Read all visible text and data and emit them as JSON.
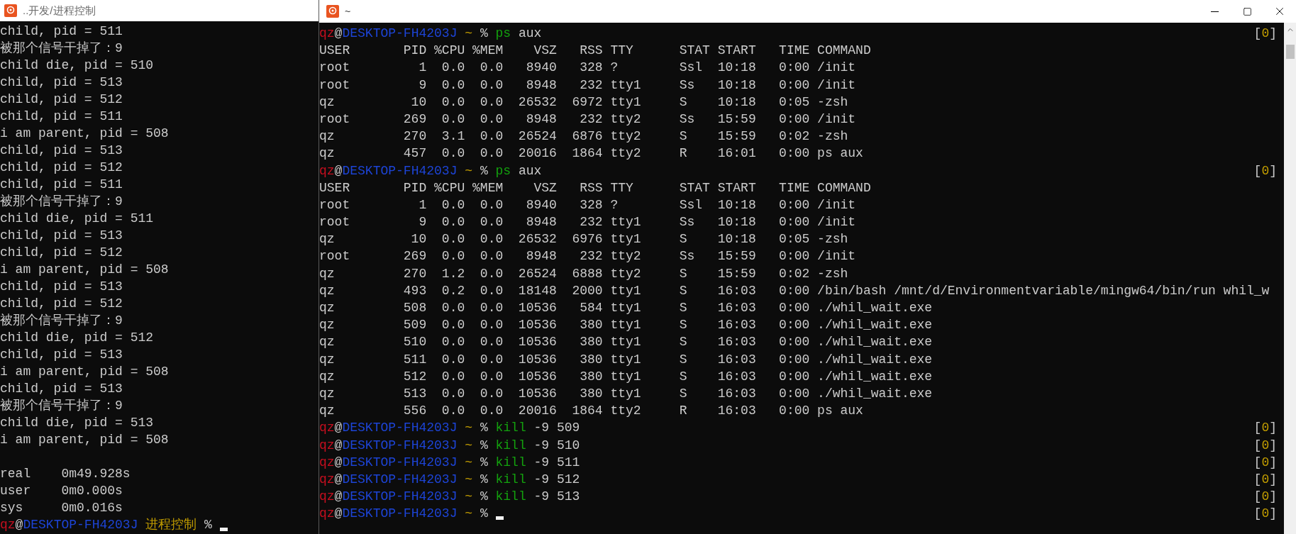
{
  "windows": [
    {
      "title": "..开发/进程控制",
      "lines": [
        {
          "kind": "output",
          "text": "child, pid = 511"
        },
        {
          "kind": "output",
          "text": "被那个信号干掉了：9"
        },
        {
          "kind": "output",
          "text": "child die, pid = 510"
        },
        {
          "kind": "output",
          "text": "child, pid = 513"
        },
        {
          "kind": "output",
          "text": "child, pid = 512"
        },
        {
          "kind": "output",
          "text": "child, pid = 511"
        },
        {
          "kind": "output",
          "text": "i am parent, pid = 508"
        },
        {
          "kind": "output",
          "text": "child, pid = 513"
        },
        {
          "kind": "output",
          "text": "child, pid = 512"
        },
        {
          "kind": "output",
          "text": "child, pid = 511"
        },
        {
          "kind": "output",
          "text": "被那个信号干掉了：9"
        },
        {
          "kind": "output",
          "text": "child die, pid = 511"
        },
        {
          "kind": "output",
          "text": "child, pid = 513"
        },
        {
          "kind": "output",
          "text": "child, pid = 512"
        },
        {
          "kind": "output",
          "text": "i am parent, pid = 508"
        },
        {
          "kind": "output",
          "text": "child, pid = 513"
        },
        {
          "kind": "output",
          "text": "child, pid = 512"
        },
        {
          "kind": "output",
          "text": "被那个信号干掉了：9"
        },
        {
          "kind": "output",
          "text": "child die, pid = 512"
        },
        {
          "kind": "output",
          "text": "child, pid = 513"
        },
        {
          "kind": "output",
          "text": "i am parent, pid = 508"
        },
        {
          "kind": "output",
          "text": "child, pid = 513"
        },
        {
          "kind": "output",
          "text": "被那个信号干掉了：9"
        },
        {
          "kind": "output",
          "text": "child die, pid = 513"
        },
        {
          "kind": "output",
          "text": "i am parent, pid = 508"
        },
        {
          "kind": "blank"
        },
        {
          "kind": "output",
          "text": "real    0m49.928s"
        },
        {
          "kind": "output",
          "text": "user    0m0.000s"
        },
        {
          "kind": "output",
          "text": "sys     0m0.016s"
        },
        {
          "kind": "prompt",
          "user": "qz",
          "at": "@",
          "host": "DESKTOP-FH4203J",
          "dir": "进程控制",
          "symbol": "%",
          "cursor": true
        }
      ]
    },
    {
      "title": "~",
      "lines": [
        {
          "kind": "prompt",
          "user": "qz",
          "at": "@",
          "host": "DESKTOP-FH4203J",
          "dir": "~",
          "symbol": "%",
          "command": "ps",
          "args": "aux",
          "status": {
            "open": "[",
            "code": "0",
            "close": "]"
          },
          "cursor": false
        },
        {
          "kind": "output",
          "text": "USER       PID %CPU %MEM    VSZ   RSS TTY      STAT START   TIME COMMAND"
        },
        {
          "kind": "output",
          "text": "root         1  0.0  0.0   8940   328 ?        Ssl  10:18   0:00 /init"
        },
        {
          "kind": "output",
          "text": "root         9  0.0  0.0   8948   232 tty1     Ss   10:18   0:00 /init"
        },
        {
          "kind": "output",
          "text": "qz          10  0.0  0.0  26532  6972 tty1     S    10:18   0:05 -zsh"
        },
        {
          "kind": "output",
          "text": "root       269  0.0  0.0   8948   232 tty2     Ss   15:59   0:00 /init"
        },
        {
          "kind": "output",
          "text": "qz         270  3.1  0.0  26524  6876 tty2     S    15:59   0:02 -zsh"
        },
        {
          "kind": "output",
          "text": "qz         457  0.0  0.0  20016  1864 tty2     R    16:01   0:00 ps aux"
        },
        {
          "kind": "prompt",
          "user": "qz",
          "at": "@",
          "host": "DESKTOP-FH4203J",
          "dir": "~",
          "symbol": "%",
          "command": "ps",
          "args": "aux",
          "status": {
            "open": "[",
            "code": "0",
            "close": "]"
          },
          "cursor": false
        },
        {
          "kind": "output",
          "text": "USER       PID %CPU %MEM    VSZ   RSS TTY      STAT START   TIME COMMAND"
        },
        {
          "kind": "output",
          "text": "root         1  0.0  0.0   8940   328 ?        Ssl  10:18   0:00 /init"
        },
        {
          "kind": "output",
          "text": "root         9  0.0  0.0   8948   232 tty1     Ss   10:18   0:00 /init"
        },
        {
          "kind": "output",
          "text": "qz          10  0.0  0.0  26532  6976 tty1     S    10:18   0:05 -zsh"
        },
        {
          "kind": "output",
          "text": "root       269  0.0  0.0   8948   232 tty2     Ss   15:59   0:00 /init"
        },
        {
          "kind": "output",
          "text": "qz         270  1.2  0.0  26524  6888 tty2     S    15:59   0:02 -zsh"
        },
        {
          "kind": "output",
          "text": "qz         493  0.2  0.0  18148  2000 tty1     S    16:03   0:00 /bin/bash /mnt/d/Environmentvariable/mingw64/bin/run whil_w"
        },
        {
          "kind": "output",
          "text": "qz         508  0.0  0.0  10536   584 tty1     S    16:03   0:00 ./whil_wait.exe"
        },
        {
          "kind": "output",
          "text": "qz         509  0.0  0.0  10536   380 tty1     S    16:03   0:00 ./whil_wait.exe"
        },
        {
          "kind": "output",
          "text": "qz         510  0.0  0.0  10536   380 tty1     S    16:03   0:00 ./whil_wait.exe"
        },
        {
          "kind": "output",
          "text": "qz         511  0.0  0.0  10536   380 tty1     S    16:03   0:00 ./whil_wait.exe"
        },
        {
          "kind": "output",
          "text": "qz         512  0.0  0.0  10536   380 tty1     S    16:03   0:00 ./whil_wait.exe"
        },
        {
          "kind": "output",
          "text": "qz         513  0.0  0.0  10536   380 tty1     S    16:03   0:00 ./whil_wait.exe"
        },
        {
          "kind": "output",
          "text": "qz         556  0.0  0.0  20016  1864 tty2     R    16:03   0:00 ps aux"
        },
        {
          "kind": "prompt",
          "user": "qz",
          "at": "@",
          "host": "DESKTOP-FH4203J",
          "dir": "~",
          "symbol": "%",
          "command": "kill",
          "args": "-9 509",
          "status": {
            "open": "[",
            "code": "0",
            "close": "]"
          },
          "cursor": false
        },
        {
          "kind": "prompt",
          "user": "qz",
          "at": "@",
          "host": "DESKTOP-FH4203J",
          "dir": "~",
          "symbol": "%",
          "command": "kill",
          "args": "-9 510",
          "status": {
            "open": "[",
            "code": "0",
            "close": "]"
          },
          "cursor": false
        },
        {
          "kind": "prompt",
          "user": "qz",
          "at": "@",
          "host": "DESKTOP-FH4203J",
          "dir": "~",
          "symbol": "%",
          "command": "kill",
          "args": "-9 511",
          "status": {
            "open": "[",
            "code": "0",
            "close": "]"
          },
          "cursor": false
        },
        {
          "kind": "prompt",
          "user": "qz",
          "at": "@",
          "host": "DESKTOP-FH4203J",
          "dir": "~",
          "symbol": "%",
          "command": "kill",
          "args": "-9 512",
          "status": {
            "open": "[",
            "code": "0",
            "close": "]"
          },
          "cursor": false
        },
        {
          "kind": "prompt",
          "user": "qz",
          "at": "@",
          "host": "DESKTOP-FH4203J",
          "dir": "~",
          "symbol": "%",
          "command": "kill",
          "args": "-9 513",
          "status": {
            "open": "[",
            "code": "0",
            "close": "]"
          },
          "cursor": false
        },
        {
          "kind": "prompt",
          "user": "qz",
          "at": "@",
          "host": "DESKTOP-FH4203J",
          "dir": "~",
          "symbol": "%",
          "status": {
            "open": "[",
            "code": "0",
            "close": "]"
          },
          "cursor": true
        }
      ]
    }
  ]
}
